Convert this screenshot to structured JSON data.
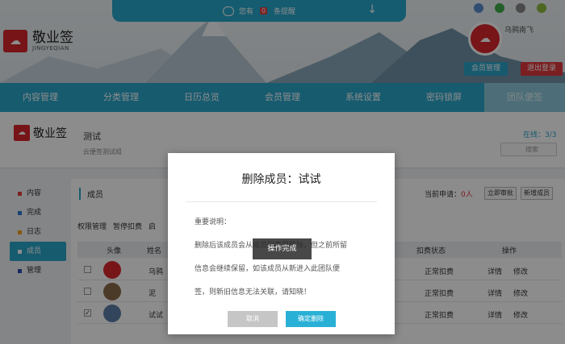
{
  "notice": {
    "prefix": "您有",
    "count": "0",
    "suffix": "条提醒"
  },
  "logo": {
    "icon": "cloud-logo-icon",
    "name": "敬业签",
    "sub": "JINGYEQIAN"
  },
  "user": {
    "name": "乌鸦南飞",
    "member_button": "会员管理",
    "logout_button": "退出登录"
  },
  "nav": [
    "内容管理",
    "分类管理",
    "日历总览",
    "会员管理",
    "系统设置",
    "密码锁屏",
    "团队便签"
  ],
  "team": {
    "logo_text": "敬业签",
    "name": "测试",
    "desc": "云便签测试组",
    "online_label": "在线：3/3",
    "search_placeholder": "搜索"
  },
  "sidebar": [
    {
      "label": "内容",
      "color": "#e23c3c"
    },
    {
      "label": "完成",
      "color": "#2a7bd6"
    },
    {
      "label": "日志",
      "color": "#f0a11c"
    },
    {
      "label": "成员",
      "color": "#ffffff"
    },
    {
      "label": "管理",
      "color": "#2a4bb0"
    }
  ],
  "members": {
    "title": "成员",
    "pending_label": "当前申请：",
    "pending_count": "0人",
    "approve_button": "立即审批",
    "add_button": "新增成员",
    "tabs": [
      "权限管理",
      "暂停扣费",
      "启"
    ],
    "headers": {
      "avatar": "头像",
      "name": "姓名",
      "billing": "扣费状态",
      "action": "操作"
    },
    "rows": [
      {
        "name": "乌鸦",
        "billing": "正常扣费",
        "detail": "详情",
        "edit": "修改",
        "checked": false
      },
      {
        "name": "泥",
        "billing": "正常扣费",
        "detail": "详情",
        "edit": "修改",
        "checked": false
      },
      {
        "name": "试试",
        "billing": "正常扣费",
        "detail": "详情",
        "edit": "修改",
        "checked": true
      }
    ]
  },
  "modal": {
    "title": "删除成员：试试",
    "body_line1": "重要说明：",
    "body_line2": "删除后该成员会从成员列表里移除，但之前所留",
    "body_line3": "信息会继续保留，如该成员从新进入此团队便",
    "body_line4": "签，则新旧信息无法关联，请知晓！",
    "toast": "操作完成",
    "cancel_button": "取消",
    "confirm_button": "确定删除"
  }
}
